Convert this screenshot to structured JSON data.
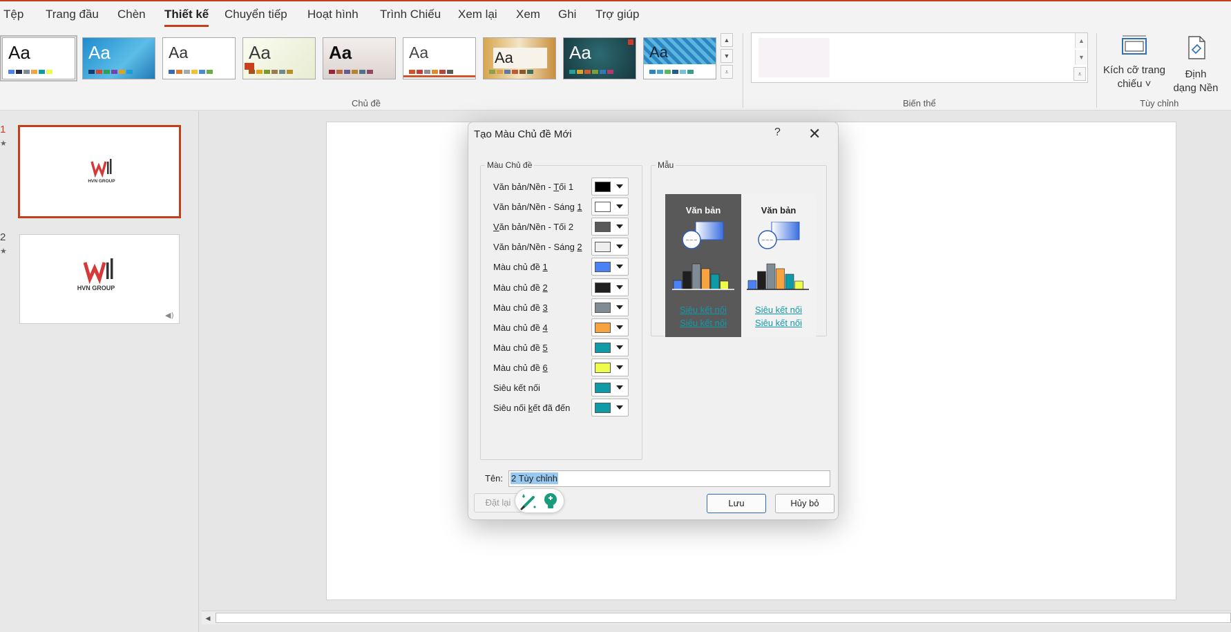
{
  "menu": {
    "items": [
      "Tệp",
      "Trang đầu",
      "Chèn",
      "Thiết kế",
      "Chuyển tiếp",
      "Hoạt hình",
      "Trình Chiếu",
      "Xem lại",
      "Xem",
      "Ghi",
      "Trợ giúp"
    ],
    "active": "Thiết kế"
  },
  "ribbon": {
    "themes": [
      {
        "sample": "Aa",
        "style": "plain"
      },
      {
        "sample": "Aa",
        "style": "blue"
      },
      {
        "sample": "Aa",
        "style": "plain-light"
      },
      {
        "sample": "Aa",
        "style": "green-arrow"
      },
      {
        "sample": "Aa",
        "style": "gray-gradient"
      },
      {
        "sample": "Aa",
        "style": "white-lines"
      },
      {
        "sample": "Aa",
        "style": "tan-blur"
      },
      {
        "sample": "Aa",
        "style": "teal-dark"
      },
      {
        "sample": "Aa",
        "style": "blue-pattern"
      }
    ],
    "themes_group_label": "Chủ đề",
    "variants_group_label": "Biến thể",
    "customize_group_label": "Tùy chỉnh",
    "slide_size_label_1": "Kích cỡ trang",
    "slide_size_label_2": "chiếu ˅",
    "format_bg_label_1": "Định",
    "format_bg_label_2": "dạng Nền"
  },
  "slides": [
    {
      "number": "1",
      "logo_text": "HVN GROUP"
    },
    {
      "number": "2",
      "logo_text": "HVN GROUP"
    }
  ],
  "dialog": {
    "title": "Tạo Màu Chủ đề Mới",
    "help": "?",
    "close": "✕",
    "theme_colors_legend": "Màu Chủ đề",
    "sample_legend": "Mẫu",
    "rows": [
      {
        "pre": "Văn bản/Nền - ",
        "key": "T",
        "post": "ối 1",
        "color": "#000000"
      },
      {
        "pre": "Văn bản/Nền - Sáng ",
        "key": "1",
        "post": "",
        "color": "#ffffff"
      },
      {
        "pre": "",
        "key": "V",
        "post": "ăn bản/Nền - Tối 2",
        "color": "#595959"
      },
      {
        "pre": "Văn bản/Nền - Sáng ",
        "key": "2",
        "post": "",
        "color": "#eeeeee"
      },
      {
        "pre": "Màu chủ đề ",
        "key": "1",
        "post": "",
        "color": "#4a82f6"
      },
      {
        "pre": "Màu chủ đề ",
        "key": "2",
        "post": "",
        "color": "#1f1f1f"
      },
      {
        "pre": "Màu chủ đề ",
        "key": "3",
        "post": "",
        "color": "#7f8c95"
      },
      {
        "pre": "Màu chủ đề ",
        "key": "4",
        "post": "",
        "color": "#f7a440"
      },
      {
        "pre": "Màu chủ đề ",
        "key": "5",
        "post": "",
        "color": "#0f9aa8"
      },
      {
        "pre": "Màu chủ đề ",
        "key": "6",
        "post": "",
        "color": "#eefc4a"
      },
      {
        "pre": "Siêu kết nối",
        "key": "",
        "post": "",
        "color": "#0f9aa8"
      },
      {
        "pre": "Siêu nối ",
        "key": "k",
        "post": "ết đã đến",
        "color": "#0f9aa8"
      }
    ],
    "sample": {
      "text": "Văn bản",
      "link1": "Siêu kết nối",
      "link2": "Siêu kết nối",
      "dark_bg": "#595959",
      "light_bg": "#f2f2f2",
      "bars": [
        "#4a82f6",
        "#1f1f1f",
        "#7f8c95",
        "#f7a440",
        "#0f9aa8",
        "#eefc4a"
      ]
    },
    "name_label": "Tên:",
    "name_value": "2 Tùy chỉnh",
    "reset_label": "Đặt lại",
    "save_label": "Lưu",
    "cancel_label": "Hủy bỏ"
  },
  "colors": {
    "accent": "#c43e1c",
    "dialog_bg": "#f0f0f0"
  }
}
